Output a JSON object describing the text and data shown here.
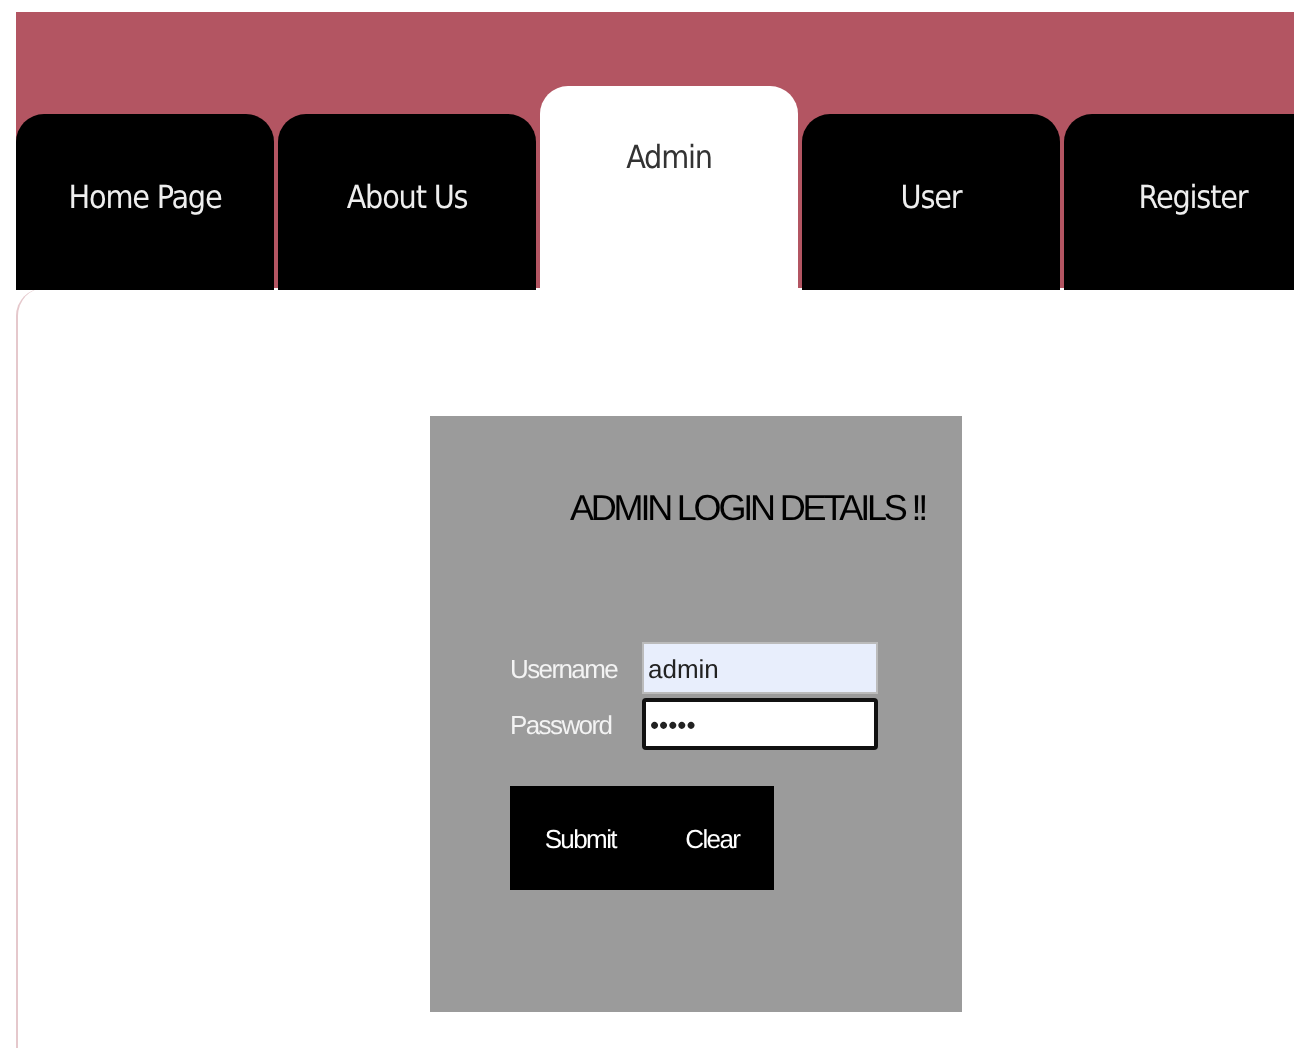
{
  "tabs": [
    {
      "label": "Home Page",
      "selected": false
    },
    {
      "label": "About Us",
      "selected": false
    },
    {
      "label": "Admin",
      "selected": true
    },
    {
      "label": "User",
      "selected": false
    },
    {
      "label": "Register",
      "selected": false
    }
  ],
  "login": {
    "title": "ADMIN LOGIN DETAILS !!",
    "fields": [
      {
        "label": "Username",
        "value": "admin",
        "focused": false,
        "autofilled": true
      },
      {
        "label": "Password",
        "value": "•••••",
        "focused": true,
        "autofilled": false
      }
    ],
    "buttons": [
      "Submit",
      "Clear"
    ]
  }
}
